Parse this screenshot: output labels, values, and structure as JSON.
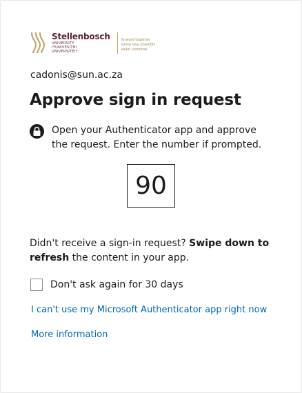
{
  "brand": {
    "name": "Stellenbosch",
    "subtitle_lines": [
      "UNIVERSITY",
      "IYUNIVESITHI",
      "UNIVERSITEIT"
    ],
    "tagline_lines": [
      "forward together",
      "sonke siya phambili",
      "saam vorentoe"
    ],
    "logo_icon": "stellenbosch-logo-icon",
    "brand_color": "#61223b",
    "gold_color": "#c6a56f"
  },
  "account": {
    "email": "cadonis@sun.ac.za"
  },
  "header": {
    "title": "Approve sign in request"
  },
  "instruction": {
    "icon": "authenticator-lock-icon",
    "text": "Open your Authenticator app and approve the request. Enter the number if prompted."
  },
  "number_match": {
    "value": "90"
  },
  "help": {
    "prefix": "Didn't receive a sign-in request? ",
    "bold": "Swipe down to refresh",
    "suffix": " the content in your app."
  },
  "remember": {
    "label": "Don't ask again for 30 days",
    "checked": false
  },
  "links": {
    "cant_use": "I can't use my Microsoft Authenticator app right now",
    "more_info": "More information"
  },
  "colors": {
    "link": "#0067b8",
    "text": "#1b1b1b"
  }
}
